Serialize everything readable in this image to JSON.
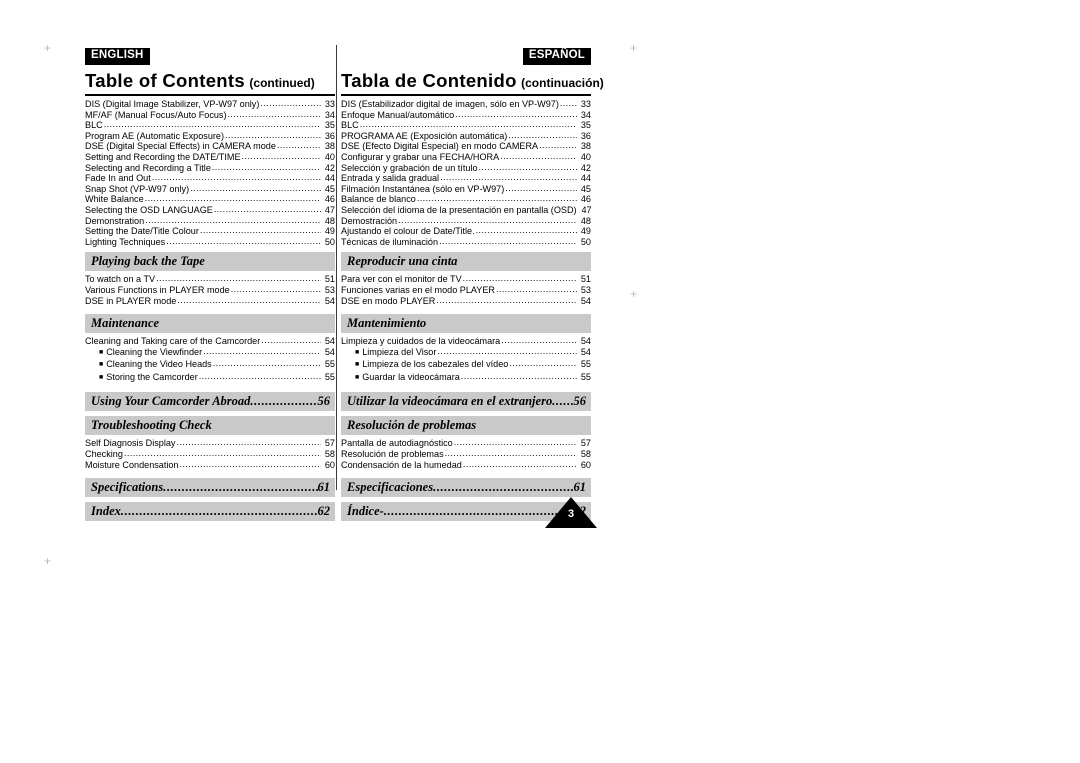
{
  "page": {
    "page_number": "3"
  },
  "left": {
    "language_chip": "ENGLISH",
    "title_main": "Table of Contents",
    "title_sub": "(continued)",
    "entries_1": [
      {
        "label": "DIS (Digital Image Stabilizer, VP-W97 only)",
        "page": "33"
      },
      {
        "label": "MF/AF (Manual Focus/Auto Focus)",
        "page": "34"
      },
      {
        "label": "BLC",
        "page": "35"
      },
      {
        "label": "Program AE (Automatic Exposure)",
        "page": "36"
      },
      {
        "label": "DSE (Digital Special Effects) in CAMERA mode",
        "page": "38"
      },
      {
        "label": "Setting and Recording the DATE/TIME",
        "page": "40"
      },
      {
        "label": "Selecting and Recording a Title",
        "page": "42"
      },
      {
        "label": "Fade In and Out",
        "page": "44"
      },
      {
        "label": "Snap Shot (VP-W97 only)",
        "page": "45"
      },
      {
        "label": "White Balance",
        "page": "46"
      },
      {
        "label": "Selecting the OSD LANGUAGE",
        "page": "47"
      },
      {
        "label": "Demonstration",
        "page": "48"
      },
      {
        "label": "Setting the Date/Title Colour",
        "page": "49"
      },
      {
        "label": "Lighting Techniques",
        "page": "50"
      }
    ],
    "bar_playing": "Playing back the Tape",
    "entries_2": [
      {
        "label": "To watch on a TV",
        "page": "51"
      },
      {
        "label": "Various Functions in PLAYER mode",
        "page": "53"
      },
      {
        "label": "DSE in PLAYER mode",
        "page": "54"
      }
    ],
    "bar_maintenance": "Maintenance",
    "entries_3": [
      {
        "label": "Cleaning and Taking care of the Camcorder",
        "page": "54",
        "sub": false
      },
      {
        "label": "Cleaning the Viewfinder",
        "page": "54",
        "sub": true
      },
      {
        "label": "Cleaning the Video Heads",
        "page": "55",
        "sub": true
      },
      {
        "label": "Storing the Camcorder",
        "page": "55",
        "sub": true
      }
    ],
    "bar_abroad": "Using Your Camcorder Abroad",
    "bar_abroad_page": "56",
    "bar_troubleshooting": "Troubleshooting Check",
    "entries_4": [
      {
        "label": "Self Diagnosis Display",
        "page": "57"
      },
      {
        "label": "Checking",
        "page": "58"
      },
      {
        "label": "Moisture Condensation",
        "page": "60"
      }
    ],
    "bar_specs": "Specifications",
    "bar_specs_page": "61",
    "bar_index": "Index",
    "bar_index_page": "62"
  },
  "right": {
    "language_chip": "ESPAÑOL",
    "title_main": "Tabla de Contenido",
    "title_sub": "(continuación)",
    "entries_1": [
      {
        "label": "DIS (Estabilizador digital de imagen, sólo en VP-W97)",
        "page": "33"
      },
      {
        "label": "Enfoque Manual/automático",
        "page": "34"
      },
      {
        "label": "BLC",
        "page": "35"
      },
      {
        "label": "PROGRAMA AE (Exposición automática)",
        "page": "36"
      },
      {
        "label": "DSE (Efecto Digital Especial) en modo CAMERA",
        "page": "38"
      },
      {
        "label": "Configurar y grabar una FECHA/HORA",
        "page": "40"
      },
      {
        "label": "Selección y grabación de un título",
        "page": "42"
      },
      {
        "label": "Entrada y salida gradual",
        "page": "44"
      },
      {
        "label": "Filmación Instantánea (sólo en VP-W97)",
        "page": "45"
      },
      {
        "label": "Balance de blanco",
        "page": "46"
      },
      {
        "label": "Selección del idioma de la presentación en pantalla (OSD)",
        "page": "47"
      },
      {
        "label": "Demostración",
        "page": "48"
      },
      {
        "label": "Ajustando el colour de Date/Title.",
        "page": "49"
      },
      {
        "label": "Técnicas de iluminación",
        "page": "50"
      }
    ],
    "bar_playing": "Reproducir una cinta",
    "entries_2": [
      {
        "label": "Para ver con el monitor de TV",
        "page": "51"
      },
      {
        "label": "Funciones varias en el modo PLAYER",
        "page": "53"
      },
      {
        "label": "DSE en modo PLAYER",
        "page": "54"
      }
    ],
    "bar_maintenance": "Mantenimiento",
    "entries_3": [
      {
        "label": "Limpieza y cuidados de la videocámara",
        "page": "54",
        "sub": false
      },
      {
        "label": "Limpieza del Visor",
        "page": "54",
        "sub": true
      },
      {
        "label": "Limpieza de los cabezales del vídeo",
        "page": "55",
        "sub": true
      },
      {
        "label": "Guardar la videocámara",
        "page": "55",
        "sub": true
      }
    ],
    "bar_abroad": "Utilizar la videocámara en el extranjero",
    "bar_abroad_page": "56",
    "bar_troubleshooting": "Resolución de problemas",
    "entries_4": [
      {
        "label": "Pantalla de autodiagnóstico",
        "page": "57"
      },
      {
        "label": "Resolución de problemas",
        "page": "58"
      },
      {
        "label": "Condensación de la humedad",
        "page": "60"
      }
    ],
    "bar_specs": "Especificaciones",
    "bar_specs_page": "61",
    "bar_index": "Índice-",
    "bar_index_page": "62"
  },
  "icons": {
    "bullet": "■",
    "dot_leader": "."
  }
}
